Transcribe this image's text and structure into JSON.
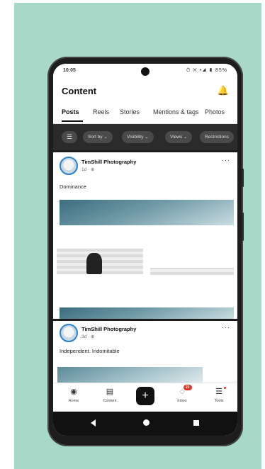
{
  "status": {
    "time": "10:05",
    "icons": "⏱ ✕ ▾◢ ▮ 85%"
  },
  "header": {
    "title": "Content"
  },
  "tabs": [
    {
      "label": "Posts"
    },
    {
      "label": "Reels"
    },
    {
      "label": "Stories"
    },
    {
      "label": "Mentions & tags"
    },
    {
      "label": "Photos"
    }
  ],
  "filters": [
    {
      "label": "Sort by ⌄"
    },
    {
      "label": "Visibility ⌄"
    },
    {
      "label": "Views ⌄"
    },
    {
      "label": "Restrictions"
    }
  ],
  "posts": [
    {
      "author": "TimShill Photography",
      "meta": "1d · ⊕",
      "caption": "Dominance",
      "more": "···"
    },
    {
      "author": "TimShill Photography",
      "meta": "3d · ⊕",
      "caption": "Independent. Indomitable",
      "more": "···"
    }
  ],
  "nav": {
    "items": [
      {
        "label": "Home"
      },
      {
        "label": "Content"
      },
      {
        "label": "Inbox",
        "badge": "21"
      },
      {
        "label": "Tools"
      }
    ],
    "fab": "+"
  },
  "colors": {
    "accent": "#2f7fcf",
    "badge": "#e0352b",
    "backdrop": "#a7d8c8"
  }
}
